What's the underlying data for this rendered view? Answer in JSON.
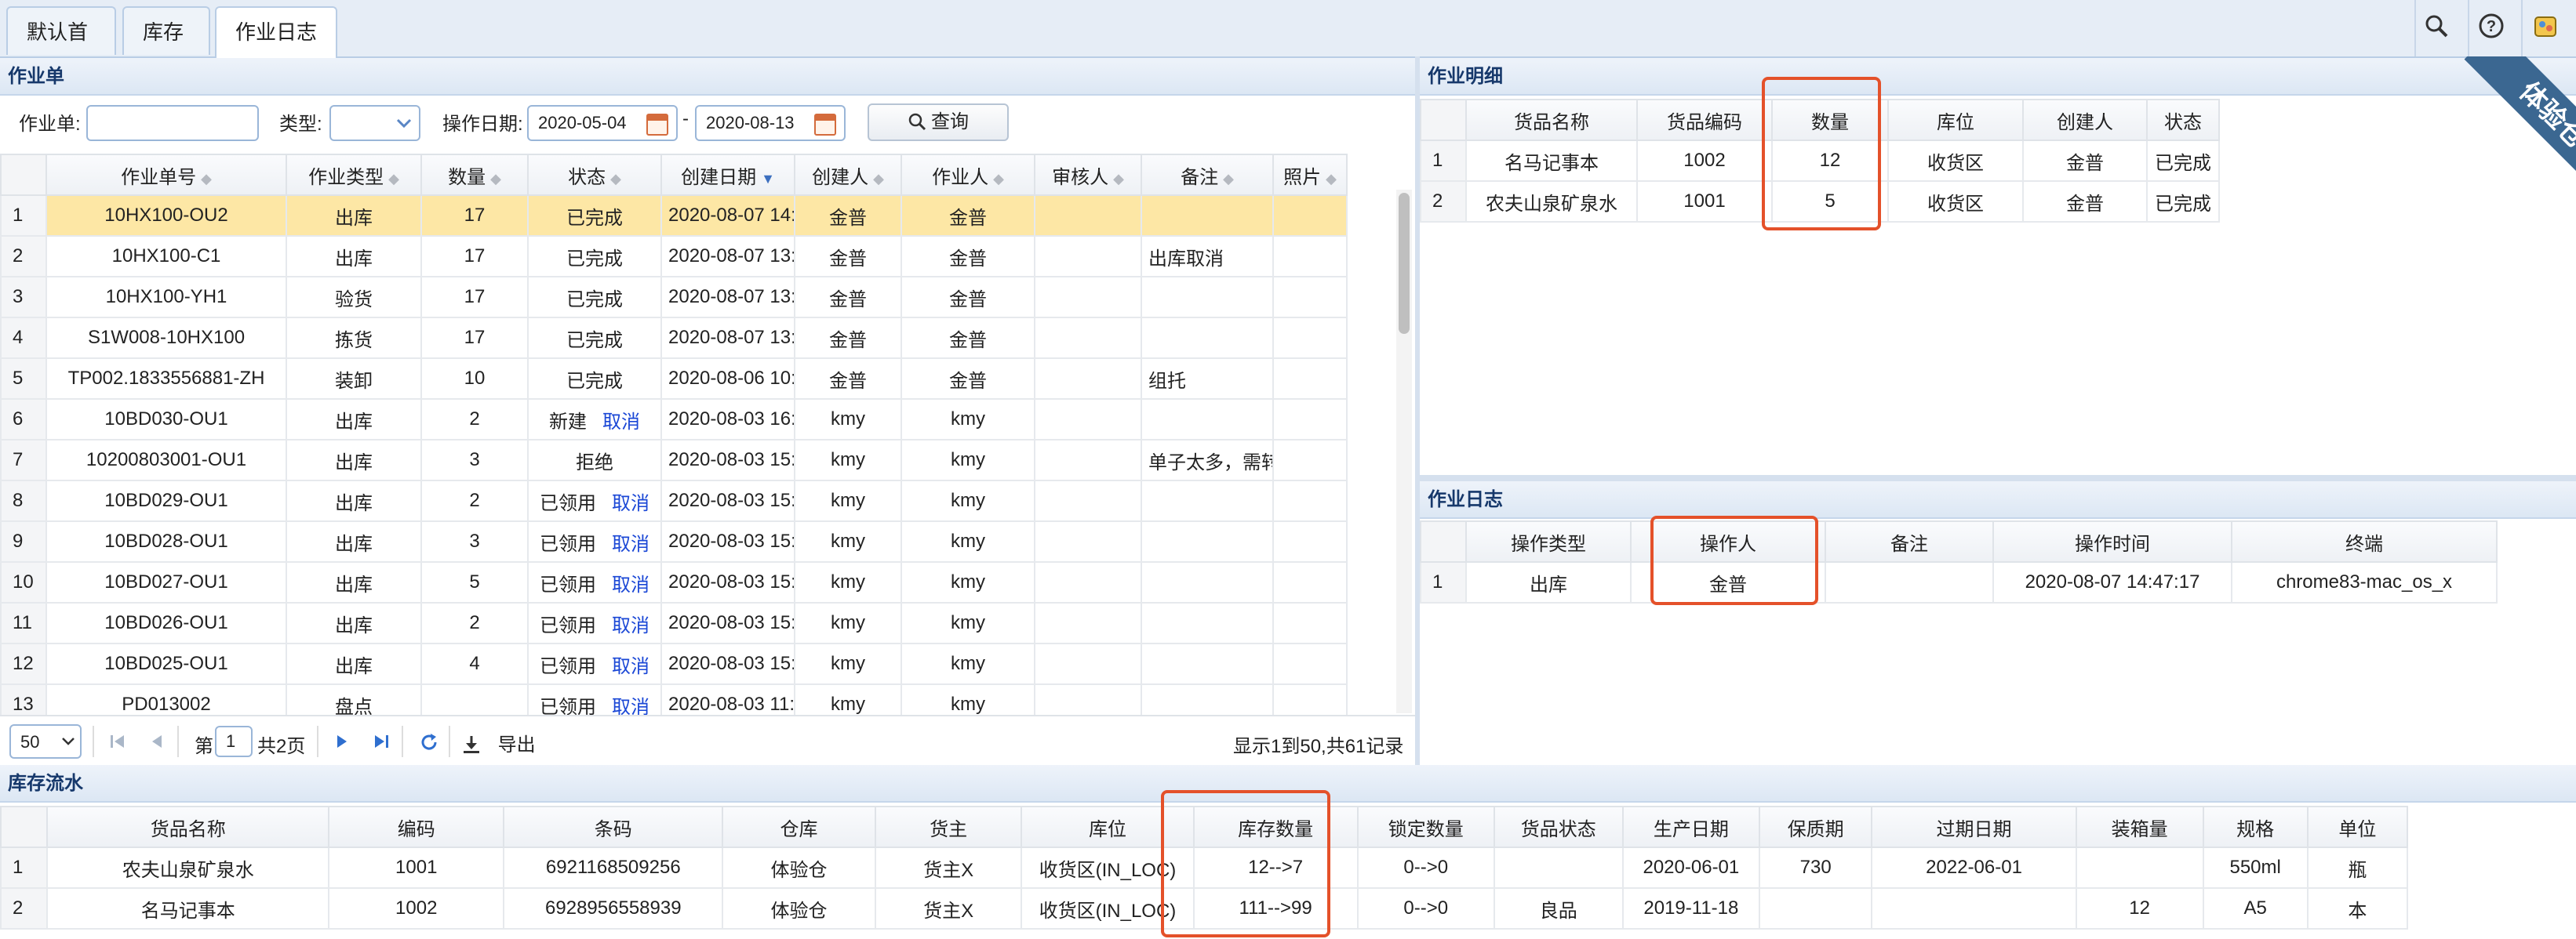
{
  "tabs": [
    {
      "label": "默认首页",
      "closable": false
    },
    {
      "label": "库存",
      "closable": true
    },
    {
      "label": "作业日志",
      "closable": true
    }
  ],
  "toolbar": {
    "icons": [
      "search-icon",
      "help-icon",
      "skin-icon"
    ],
    "help_glyph": "?"
  },
  "corner_ribbon": "体验仓",
  "work_orders": {
    "title": "作业单",
    "search": {
      "order_label": "作业单:",
      "order_value": "",
      "type_label": "类型:",
      "type_value": "",
      "date_label": "操作日期:",
      "date_from": "2020-05-04",
      "date_sep": "-",
      "date_to": "2020-08-13",
      "query_button": "查询"
    },
    "columns": [
      "作业单号",
      "作业类型",
      "数量",
      "状态",
      "创建日期",
      "创建人",
      "作业人",
      "审核人",
      "备注",
      "照片"
    ],
    "rows": [
      {
        "n": "1",
        "no": "10HX100-OU2",
        "type": "出库",
        "qty": "17",
        "status": "已完成",
        "action": "",
        "created": "2020-08-07 14:",
        "creator": "金普",
        "worker": "金普",
        "auditor": "",
        "remark": "",
        "photo": ""
      },
      {
        "n": "2",
        "no": "10HX100-C1",
        "type": "出库",
        "qty": "17",
        "status": "已完成",
        "action": "",
        "created": "2020-08-07 13:",
        "creator": "金普",
        "worker": "金普",
        "auditor": "",
        "remark": "出库取消",
        "photo": ""
      },
      {
        "n": "3",
        "no": "10HX100-YH1",
        "type": "验货",
        "qty": "17",
        "status": "已完成",
        "action": "",
        "created": "2020-08-07 13:",
        "creator": "金普",
        "worker": "金普",
        "auditor": "",
        "remark": "",
        "photo": ""
      },
      {
        "n": "4",
        "no": "S1W008-10HX100",
        "type": "拣货",
        "qty": "17",
        "status": "已完成",
        "action": "",
        "created": "2020-08-07 13:",
        "creator": "金普",
        "worker": "金普",
        "auditor": "",
        "remark": "",
        "photo": ""
      },
      {
        "n": "5",
        "no": "TP002.1833556881-ZH",
        "type": "装卸",
        "qty": "10",
        "status": "已完成",
        "action": "",
        "created": "2020-08-06 10:",
        "creator": "金普",
        "worker": "金普",
        "auditor": "",
        "remark": "组托",
        "photo": ""
      },
      {
        "n": "6",
        "no": "10BD030-OU1",
        "type": "出库",
        "qty": "2",
        "status": "新建",
        "action": "取消",
        "created": "2020-08-03 16:",
        "creator": "kmy",
        "worker": "kmy",
        "auditor": "",
        "remark": "",
        "photo": ""
      },
      {
        "n": "7",
        "no": "10200803001-OU1",
        "type": "出库",
        "qty": "3",
        "status": "拒绝",
        "action": "",
        "created": "2020-08-03 15:",
        "creator": "kmy",
        "worker": "kmy",
        "auditor": "",
        "remark": "单子太多，需转",
        "photo": ""
      },
      {
        "n": "8",
        "no": "10BD029-OU1",
        "type": "出库",
        "qty": "2",
        "status": "已领用",
        "action": "取消",
        "created": "2020-08-03 15:",
        "creator": "kmy",
        "worker": "kmy",
        "auditor": "",
        "remark": "",
        "photo": ""
      },
      {
        "n": "9",
        "no": "10BD028-OU1",
        "type": "出库",
        "qty": "3",
        "status": "已领用",
        "action": "取消",
        "created": "2020-08-03 15:",
        "creator": "kmy",
        "worker": "kmy",
        "auditor": "",
        "remark": "",
        "photo": ""
      },
      {
        "n": "10",
        "no": "10BD027-OU1",
        "type": "出库",
        "qty": "5",
        "status": "已领用",
        "action": "取消",
        "created": "2020-08-03 15:",
        "creator": "kmy",
        "worker": "kmy",
        "auditor": "",
        "remark": "",
        "photo": ""
      },
      {
        "n": "11",
        "no": "10BD026-OU1",
        "type": "出库",
        "qty": "2",
        "status": "已领用",
        "action": "取消",
        "created": "2020-08-03 15:",
        "creator": "kmy",
        "worker": "kmy",
        "auditor": "",
        "remark": "",
        "photo": ""
      },
      {
        "n": "12",
        "no": "10BD025-OU1",
        "type": "出库",
        "qty": "4",
        "status": "已领用",
        "action": "取消",
        "created": "2020-08-03 15:",
        "creator": "kmy",
        "worker": "kmy",
        "auditor": "",
        "remark": "",
        "photo": ""
      },
      {
        "n": "13",
        "no": "PD013002",
        "type": "盘点",
        "qty": "",
        "status": "已领用",
        "action": "取消",
        "created": "2020-08-03 11:",
        "creator": "kmy",
        "worker": "kmy",
        "auditor": "",
        "remark": "",
        "photo": ""
      }
    ],
    "pager": {
      "page_size": "50",
      "page_prefix": "第",
      "page_value": "1",
      "page_suffix": "共2页",
      "export": "导出",
      "summary": "显示1到50,共61记录"
    }
  },
  "details": {
    "title": "作业明细",
    "columns": [
      "货品名称",
      "货品编码",
      "数量",
      "库位",
      "创建人",
      "状态"
    ],
    "rows": [
      {
        "n": "1",
        "name": "名马记事本",
        "code": "1002",
        "qty": "12",
        "loc": "收货区",
        "creator": "金普",
        "status": "已完成"
      },
      {
        "n": "2",
        "name": "农夫山泉矿泉水",
        "code": "1001",
        "qty": "5",
        "loc": "收货区",
        "creator": "金普",
        "status": "已完成"
      }
    ]
  },
  "log": {
    "title": "作业日志",
    "columns": [
      "操作类型",
      "操作人",
      "备注",
      "操作时间",
      "终端"
    ],
    "rows": [
      {
        "n": "1",
        "type": "出库",
        "operator": "金普",
        "remark": "",
        "time": "2020-08-07 14:47:17",
        "terminal": "chrome83-mac_os_x"
      }
    ]
  },
  "stock_flow": {
    "title": "库存流水",
    "columns": [
      "货品名称",
      "编码",
      "条码",
      "仓库",
      "货主",
      "库位",
      "库存数量",
      "锁定数量",
      "货品状态",
      "生产日期",
      "保质期",
      "过期日期",
      "装箱量",
      "规格",
      "单位"
    ],
    "rows": [
      {
        "n": "1",
        "name": "农夫山泉矿泉水",
        "code": "1001",
        "barcode": "6921168509256",
        "wh": "体验仓",
        "owner": "货主X",
        "loc": "收货区(IN_LOC)",
        "qty": "12-->7",
        "locked": "0-->0",
        "state": "",
        "mfg": "2020-06-01",
        "shelf": "730",
        "exp": "2022-06-01",
        "pack": "",
        "spec": "550ml",
        "unit": "瓶"
      },
      {
        "n": "2",
        "name": "名马记事本",
        "code": "1002",
        "barcode": "6928956558939",
        "wh": "体验仓",
        "owner": "货主X",
        "loc": "收货区(IN_LOC)",
        "qty": "111-->99",
        "locked": "0-->0",
        "state": "良品",
        "mfg": "2019-11-18",
        "shelf": "",
        "exp": "",
        "pack": "12",
        "spec": "A5",
        "unit": "本"
      }
    ]
  },
  "colors": {
    "highlight_box": "#e4512a",
    "selected_row": "#fde7a5",
    "link": "#1a47d6",
    "panel_title": "#16386b"
  }
}
